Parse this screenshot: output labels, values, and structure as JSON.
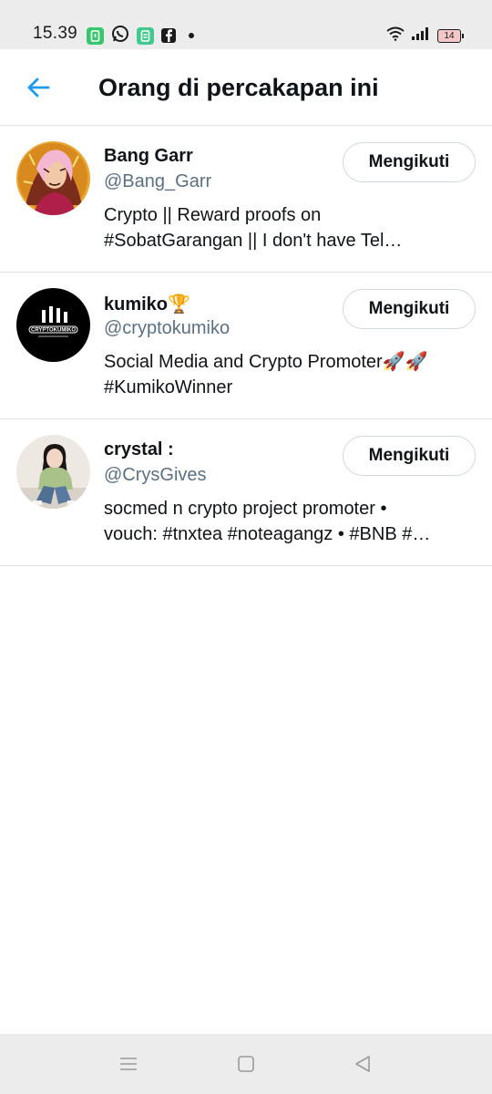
{
  "status_bar": {
    "time": "15.39",
    "battery_level": "14",
    "icons": [
      "app-notification-icon",
      "whatsapp-icon",
      "app-notification-icon",
      "facebook-icon",
      "notification-dot-icon",
      "wifi-icon",
      "signal-icon",
      "battery-icon"
    ]
  },
  "header": {
    "title": "Orang di percakapan ini",
    "back_icon": "arrow-left-icon",
    "accent_color": "#1d9bf0"
  },
  "users": [
    {
      "name": "Bang Garr",
      "handle": "@Bang_Garr",
      "bio_line1": "Crypto || Reward proofs on",
      "bio_line2": "#SobatGarangan ||           I don't have Tel…",
      "follow_label": "Mengikuti"
    },
    {
      "name": "kumiko🏆",
      "handle": "@cryptokumiko",
      "bio_line1": "Social Media and Crypto Promoter🚀🚀",
      "bio_line2": "#KumikoWinner",
      "follow_label": "Mengikuti",
      "avatar_text": "CRYPTOKUMIKO"
    },
    {
      "name": "crystal :",
      "handle": "@CrysGives",
      "bio_line1": "socmed n crypto project promoter •",
      "bio_line2": "vouch: #tnxtea #noteagangz • #BNB #…",
      "follow_label": "Mengikuti"
    }
  ],
  "nav_bar": {
    "icons": [
      "menu-icon",
      "home-square-icon",
      "back-triangle-icon"
    ]
  }
}
